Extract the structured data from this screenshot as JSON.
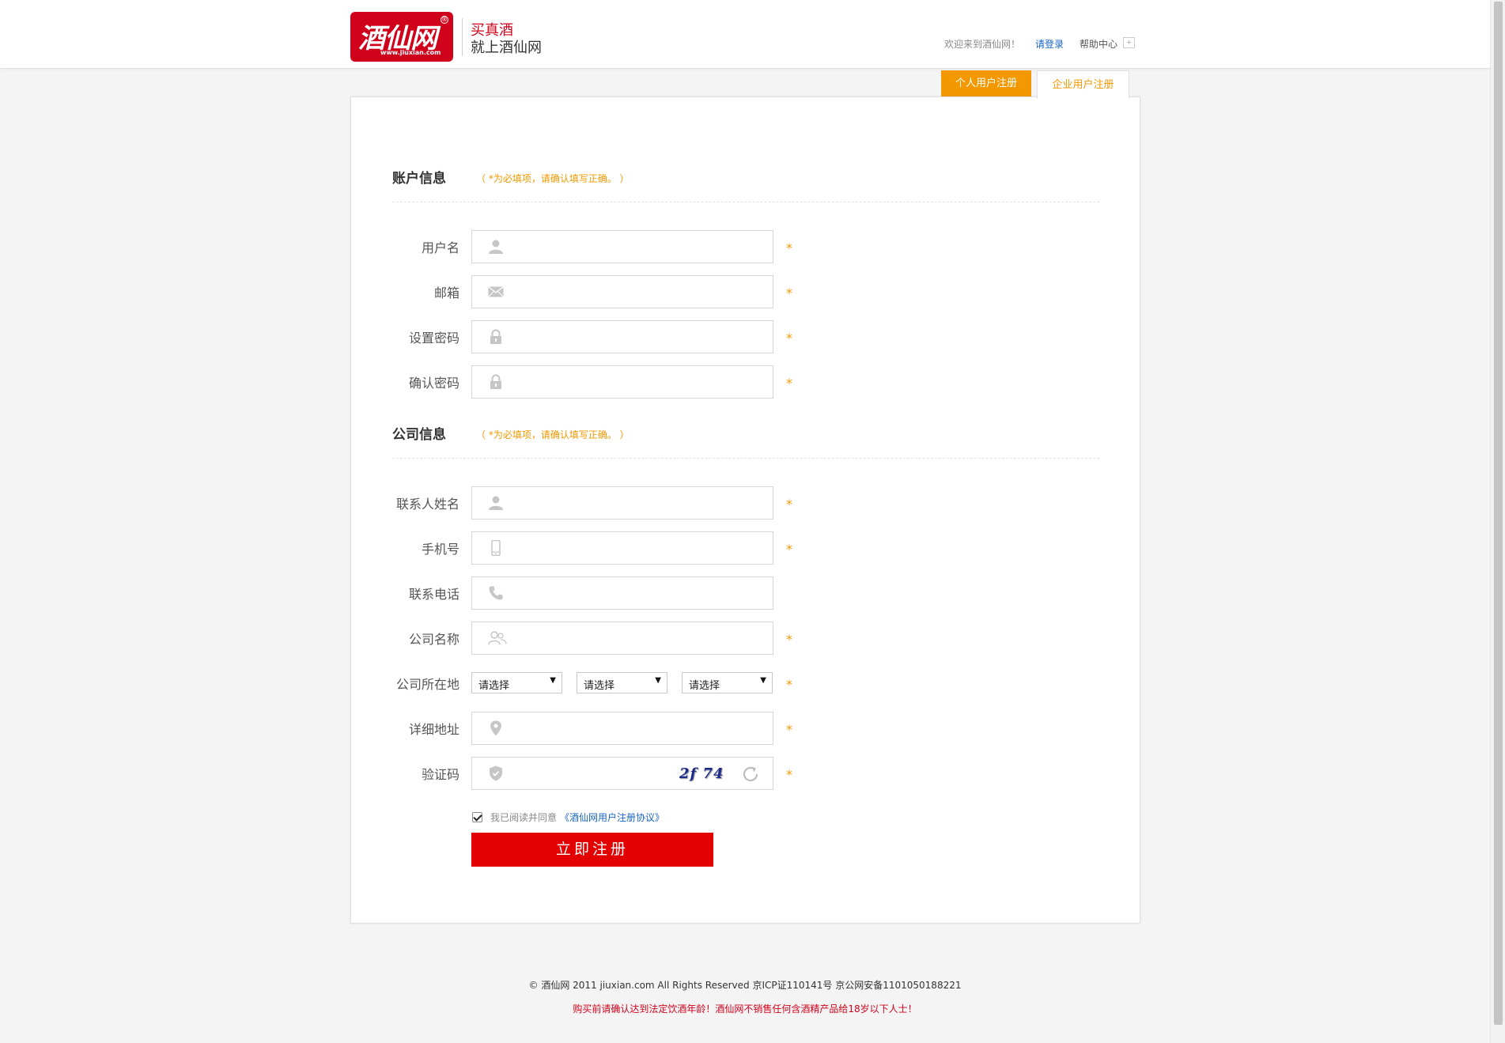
{
  "header": {
    "logo_text": "酒仙网",
    "logo_url_text": "www.jiuxian.com",
    "logo_registered": "®",
    "slogan_line1": "买真酒",
    "slogan_line2": "就上酒仙网",
    "welcome": "欢迎来到酒仙网！",
    "login_link": "请登录",
    "help_center": "帮助中心",
    "help_arrow": "+"
  },
  "tabs": {
    "personal": "个人用户注册",
    "company": "企业用户注册",
    "active": "company"
  },
  "account_section": {
    "title": "账户信息",
    "note": "（ *为必填项，请确认填写正确。 ）",
    "fields": [
      {
        "label": "用户名",
        "icon": "user-icon",
        "value": "",
        "required": "*"
      },
      {
        "label": "邮箱",
        "icon": "mail-icon",
        "value": "",
        "required": "*"
      },
      {
        "label": "设置密码",
        "icon": "lock-icon",
        "value": "",
        "required": "*"
      },
      {
        "label": "确认密码",
        "icon": "lock-icon",
        "value": "",
        "required": "*"
      }
    ]
  },
  "company_section": {
    "title": "公司信息",
    "note": "（ *为必填项，请确认填写正确。 ）",
    "fields": [
      {
        "label": "联系人姓名",
        "icon": "user-icon",
        "value": "",
        "required": "*"
      },
      {
        "label": "手机号",
        "icon": "mobile-icon",
        "value": "",
        "required": "*"
      },
      {
        "label": "联系电话",
        "icon": "phone-icon",
        "value": ""
      },
      {
        "label": "公司名称",
        "icon": "group-icon",
        "value": "",
        "required": "*"
      }
    ],
    "location": {
      "label": "公司所在地",
      "selects": [
        "请选择",
        "请选择",
        "请选择"
      ],
      "required": "*"
    },
    "address": {
      "label": "详细地址",
      "icon": "location-pin-icon",
      "value": "",
      "required": "*"
    },
    "captcha": {
      "label": "验证码",
      "icon": "shield-icon",
      "value": "",
      "captcha_text": "2f 74",
      "required": "*"
    }
  },
  "agreement": {
    "checked": true,
    "text": "我已阅读并同意",
    "link": "《酒仙网用户注册协议》"
  },
  "submit_label": "立即注册",
  "footer": {
    "copyright": "© 酒仙网 2011 jiuxian.com All Rights Reserved 京ICP证110141号 京公网安备1101050188221",
    "warning": "购买前请确认达到法定饮酒年龄！酒仙网不销售任何含酒精产品给18岁以下人士！"
  },
  "colors": {
    "brand_red": "#d0021b",
    "accent_orange": "#f39800",
    "submit_red": "#e20000",
    "link_blue": "#1a64c6"
  }
}
